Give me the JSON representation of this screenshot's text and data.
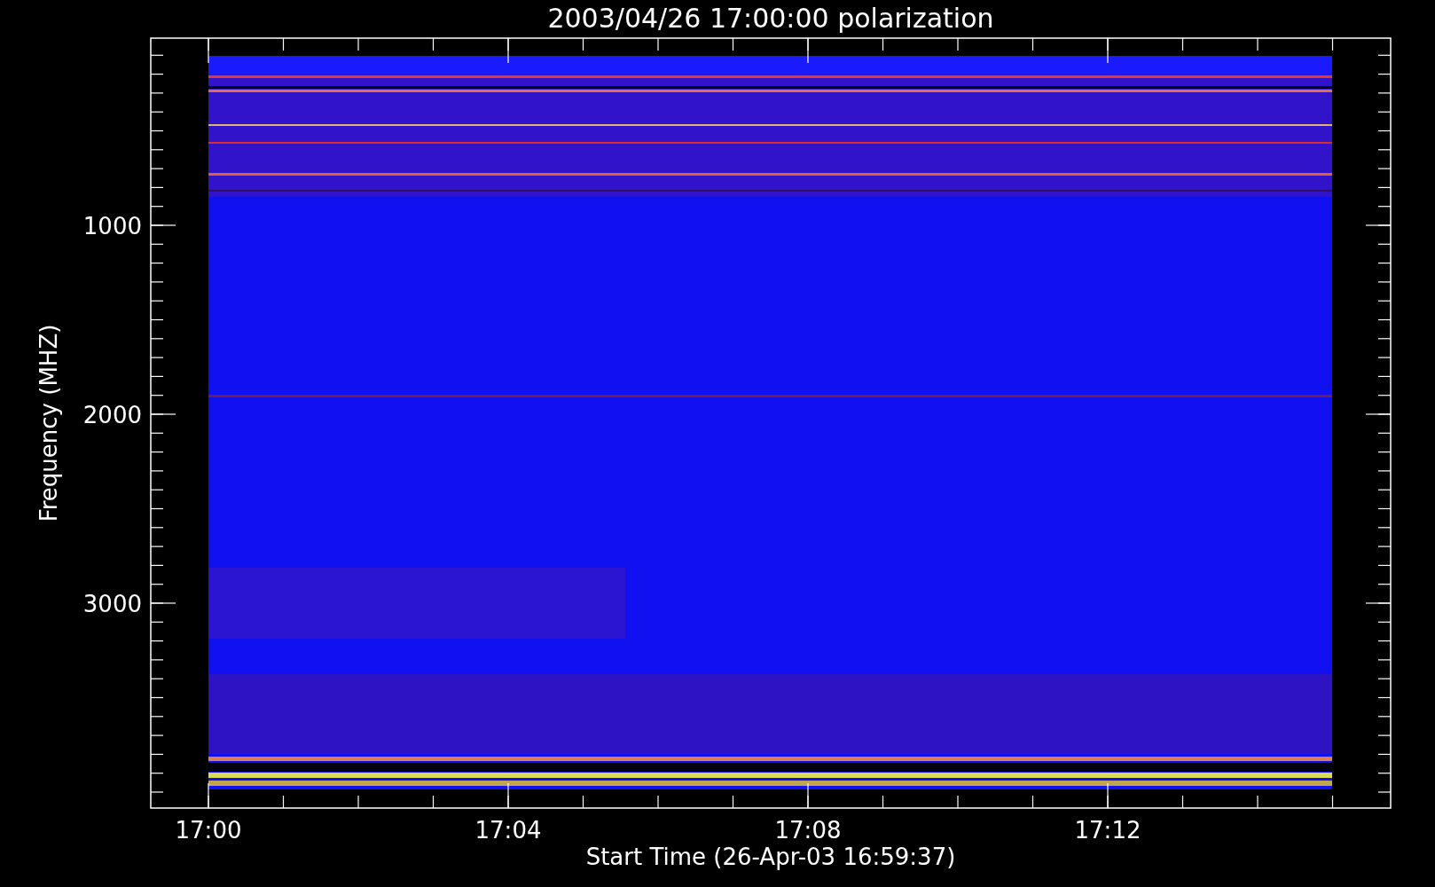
{
  "plot": {
    "title": "2003/04/26 17:00:00 polarization",
    "xlabel": "Start Time (26-Apr-03 16:59:37)",
    "ylabel": "Frequency (MHZ)",
    "xticks": [
      "17:00",
      "17:04",
      "17:08",
      "17:12"
    ],
    "yticks": [
      "1000",
      "2000",
      "3000"
    ]
  }
}
